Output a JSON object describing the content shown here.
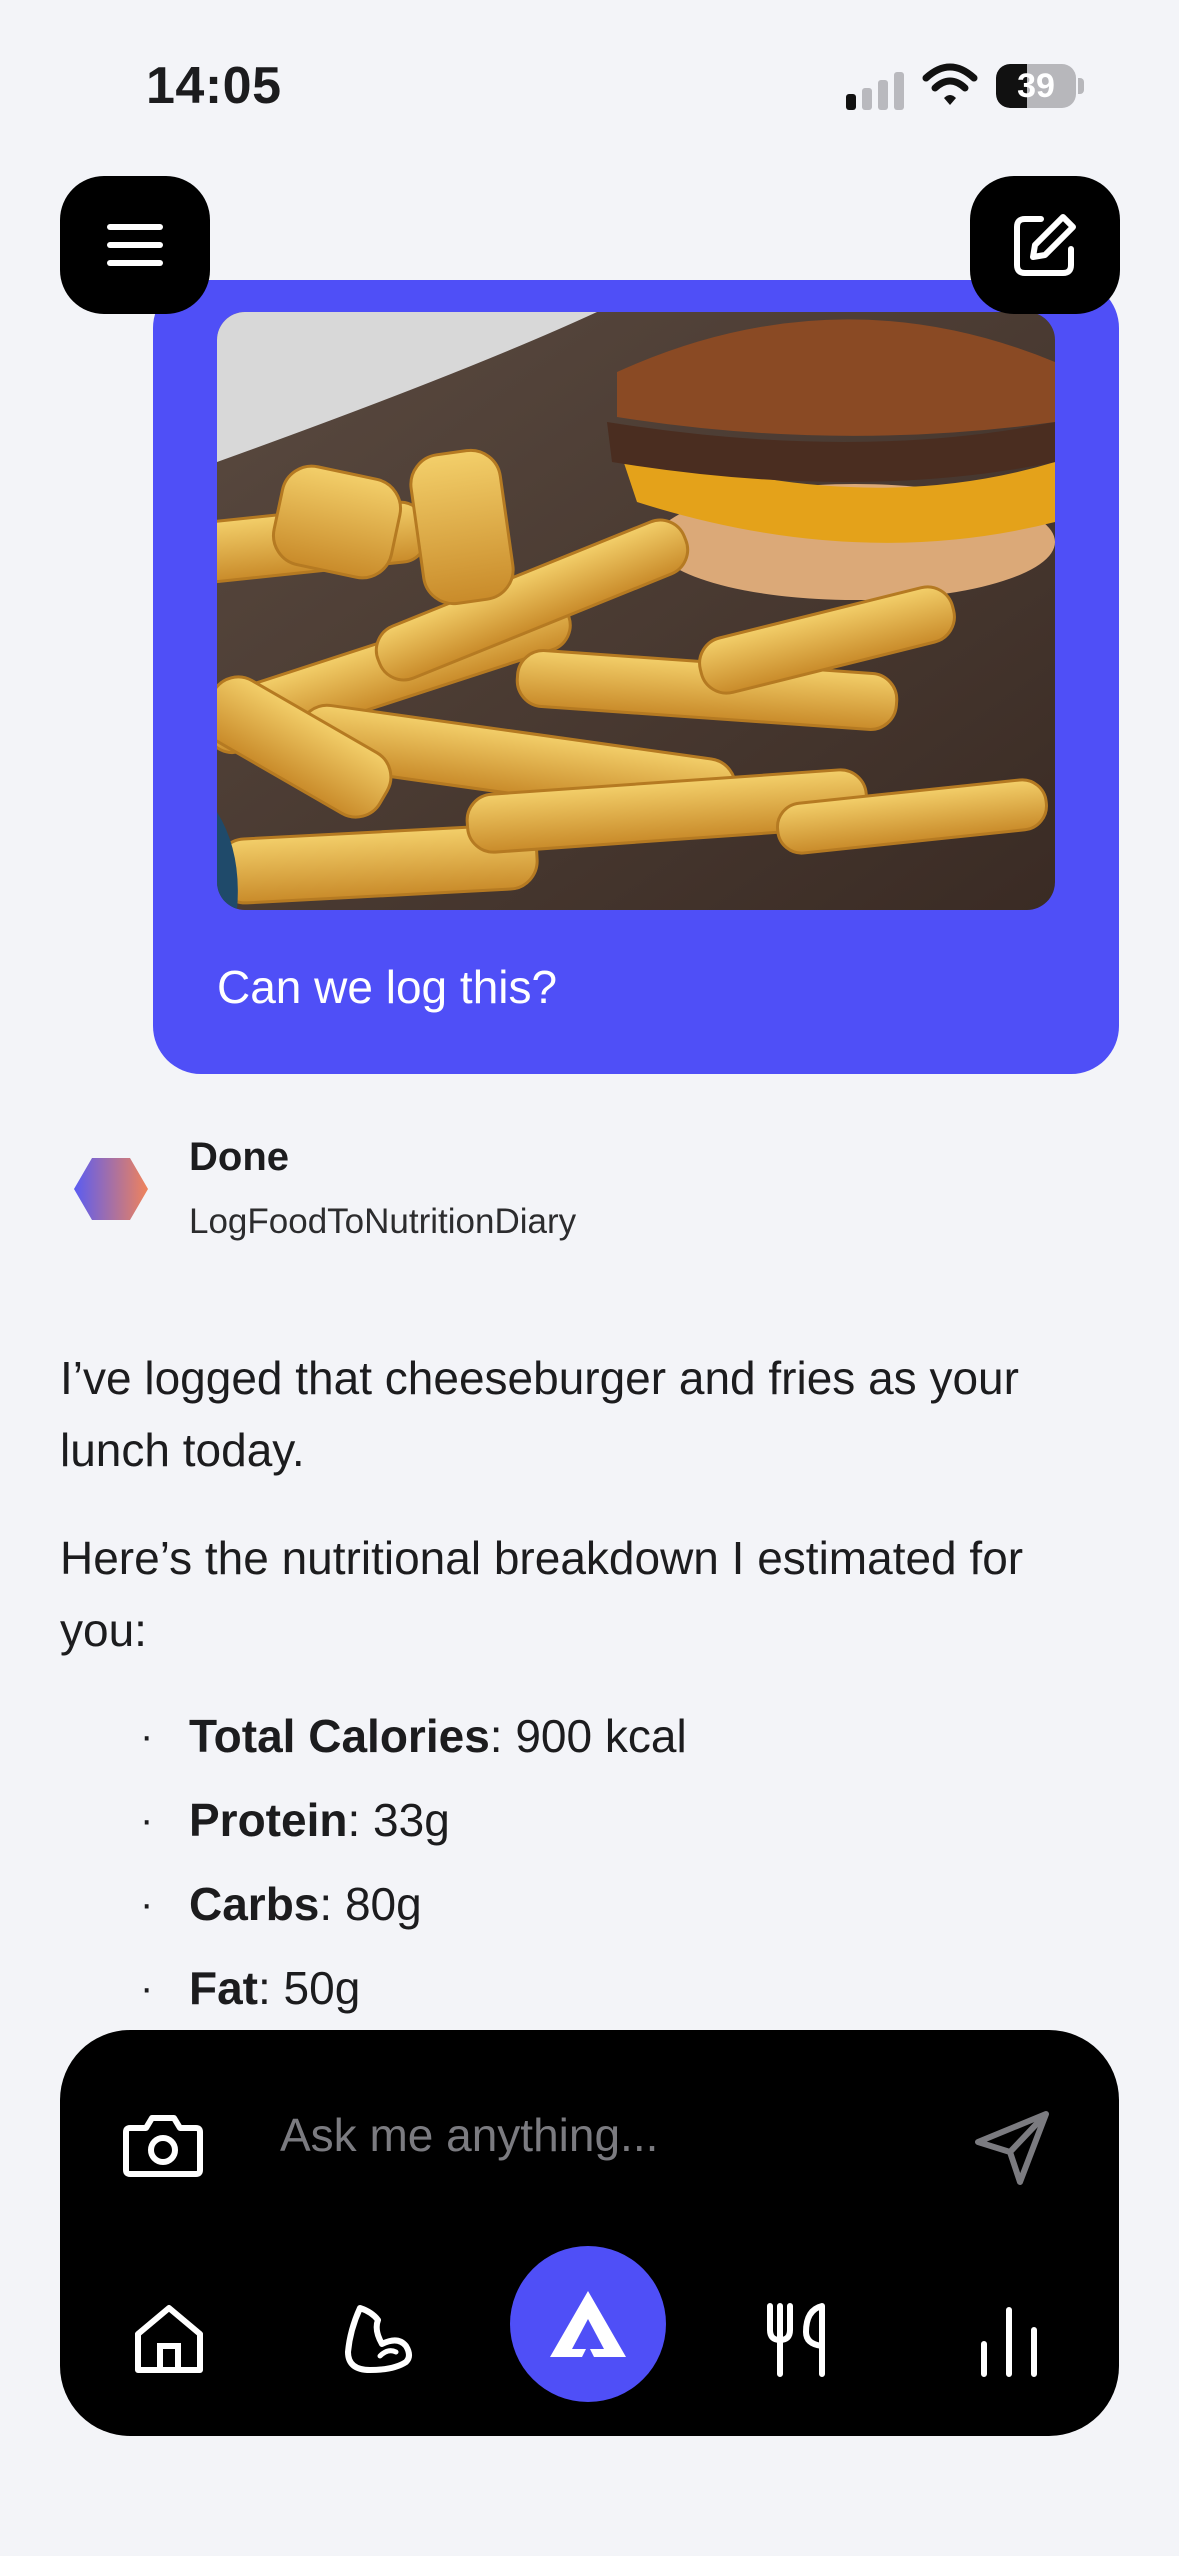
{
  "status_bar": {
    "time": "14:05",
    "battery": "39",
    "battery_level": 0.39
  },
  "chat": {
    "user_message": "Can we log this?",
    "user_image": "burger-and-fries-photo",
    "tool_call": {
      "status": "Done",
      "name": "LogFoodToNutritionDiary"
    },
    "response": {
      "paragraph1": "I’ve logged that cheeseburger and fries as your lunch today.",
      "paragraph2": "Here’s the nutritional breakdown I estimated for you:",
      "bullets": [
        {
          "label": "Total Calories",
          "value": ": 900 kcal"
        },
        {
          "label": "Protein",
          "value": ": 33g"
        },
        {
          "label": "Carbs",
          "value": ": 80g"
        },
        {
          "label": "Fat",
          "value": ": 50g"
        }
      ]
    }
  },
  "composer": {
    "placeholder": "Ask me anything..."
  },
  "nav": [
    "home-icon",
    "muscle-icon",
    "app-logo-icon",
    "fork-knife-icon",
    "stats-icon"
  ],
  "colors": {
    "accent": "#4f4ff7",
    "background": "#f3f4f8",
    "bar": "#000000"
  }
}
